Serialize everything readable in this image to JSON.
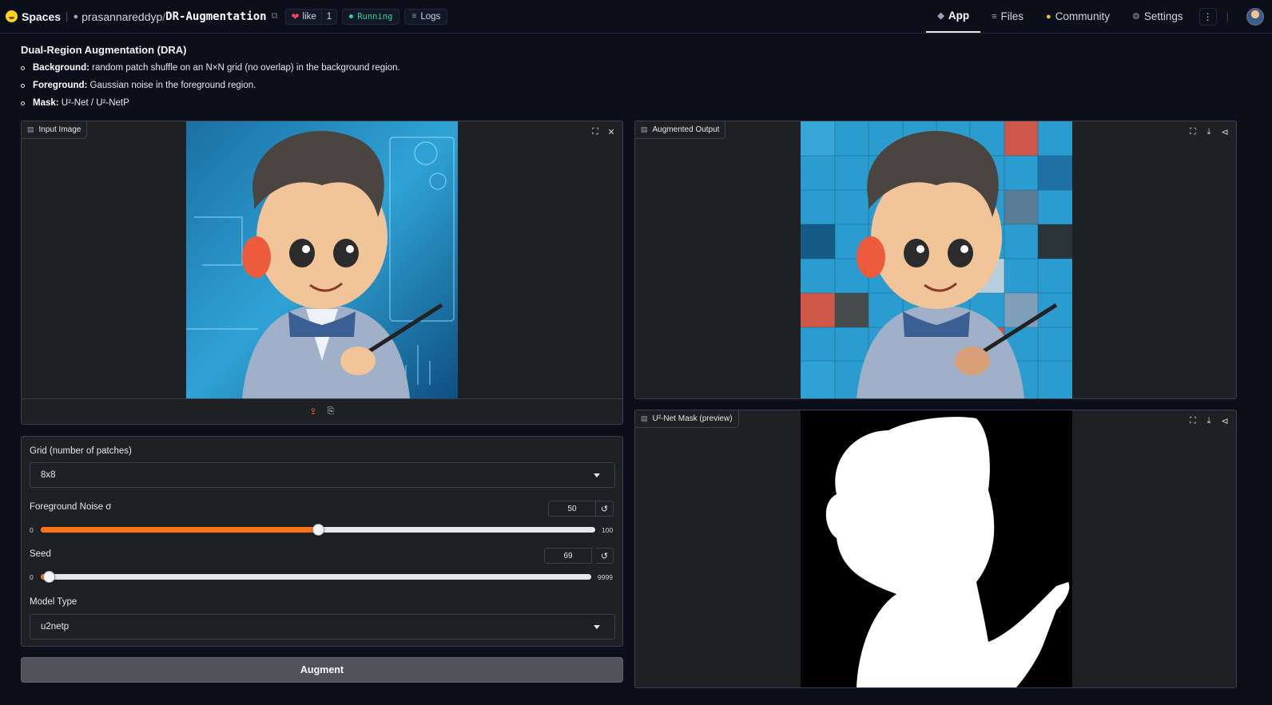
{
  "nav": {
    "spaces_label": "Spaces",
    "owner": "prasannareddyp",
    "slash": "/",
    "repo": "DR-Augmentation",
    "like_label": "like",
    "like_count": "1",
    "status": "Running",
    "logs_label": "Logs",
    "tabs": [
      {
        "label": "App",
        "icon": "app-icon",
        "active": true
      },
      {
        "label": "Files",
        "icon": "files-icon",
        "active": false
      },
      {
        "label": "Community",
        "icon": "community-icon",
        "active": false
      },
      {
        "label": "Settings",
        "icon": "gear-icon",
        "active": false
      }
    ],
    "more_label": "⋮"
  },
  "header": {
    "title": "Dual-Region Augmentation (DRA)",
    "bullets": [
      {
        "bold": "Background:",
        "text": " random patch shuffle on an N×N grid (no overlap) in the background region."
      },
      {
        "bold": "Foreground:",
        "text": " Gaussian noise in the foreground region."
      },
      {
        "bold": "Mask:",
        "text": " U²-Net / U²-NetP"
      }
    ]
  },
  "panels": {
    "input": {
      "label": "Input Image"
    },
    "output": {
      "label": "Augmented Output"
    },
    "mask": {
      "label": "U²-Net Mask (preview)"
    }
  },
  "controls": {
    "grid": {
      "label": "Grid (number of patches)",
      "value": "8x8"
    },
    "noise": {
      "label": "Foreground Noise σ",
      "value": "50",
      "min": "0",
      "max": "100",
      "fraction": 0.5
    },
    "seed": {
      "label": "Seed",
      "value": "69",
      "min": "0",
      "max": "9999",
      "fraction": 0.0069
    },
    "model": {
      "label": "Model Type",
      "value": "u2netp"
    },
    "reset_icon": "↺"
  },
  "augment_label": "Augment",
  "colors": {
    "accent": "#f97316",
    "background": "#0b0f19",
    "panel": "#1f2023",
    "running": "#34d399",
    "heart": "#f43f5e"
  }
}
